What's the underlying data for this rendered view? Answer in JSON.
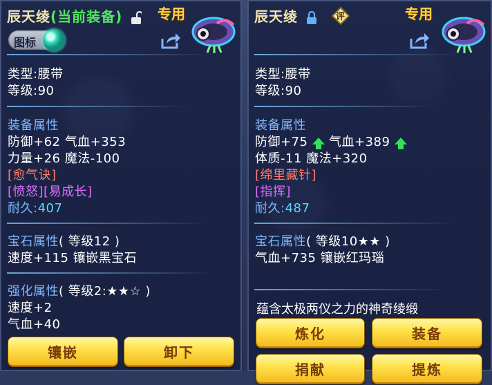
{
  "left": {
    "title": "辰天绫",
    "title_status": "(当前装备)",
    "tag": "专用",
    "badge_label": "图标",
    "type_label": "类型:",
    "type_value": "腰带",
    "level_label": "等级:",
    "level_value": "90",
    "attr_header": "装备属性",
    "attr_line1": "防御+62 气血+353",
    "attr_line2": "力量+26 魔法-100",
    "skill1": "[愈气诀]",
    "skill2": "[愤怒][易成长]",
    "durability_label": "耐久:",
    "durability_value": "407",
    "gem_header": "宝石属性",
    "gem_level": "( 等级12 )",
    "gem_line": "速度+115 镶嵌黑宝石",
    "enhance_header": "强化属性",
    "enhance_level": "( 等级2:★★☆ )",
    "enhance_line1": "速度+2",
    "enhance_line2": "气血+40",
    "btn_inlay": "镶嵌",
    "btn_unequip": "卸下"
  },
  "right": {
    "title": "辰天绫",
    "rate_icon_text": "评",
    "tag": "专用",
    "type_label": "类型:",
    "type_value": "腰带",
    "level_label": "等级:",
    "level_value": "90",
    "attr_header": "装备属性",
    "attr_line1a": "防御+75",
    "attr_line1b": " 气血+389",
    "attr_line2": "体质-11 魔法+320",
    "skill1": "[绵里藏针]",
    "skill2": "[指挥]",
    "durability_label": "耐久:",
    "durability_value": "487",
    "gem_header": "宝石属性",
    "gem_level": "( 等级10★★ )",
    "gem_line": "气血+735 镶嵌红玛瑙",
    "description": "蕴含太极两仪之力的神奇绫缎",
    "btn_refine": "炼化",
    "btn_equip": "装备",
    "btn_donate": "捐献",
    "btn_extract": "提炼"
  },
  "colors": {
    "label": "#7fb6ff",
    "cyan_value": "#5fd4ff",
    "skill_red": "#ff7a6b",
    "skill_magenta": "#e06bff",
    "equipped_green": "#52e85e",
    "tag_gold": "#ffd23f",
    "up_arrow": "#35e05a"
  }
}
